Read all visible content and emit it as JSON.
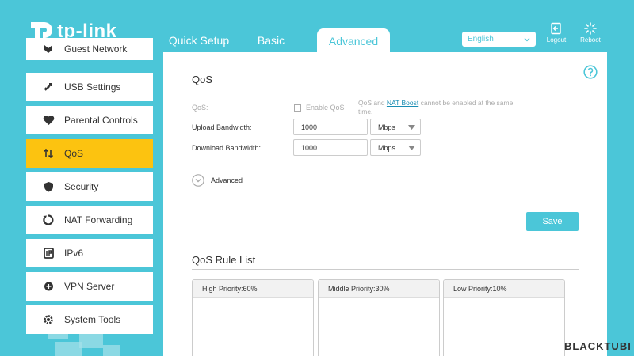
{
  "brand": {
    "name": "tp-link"
  },
  "tabs": [
    {
      "label": "Quick Setup",
      "active": false
    },
    {
      "label": "Basic",
      "active": false
    },
    {
      "label": "Advanced",
      "active": true
    }
  ],
  "header": {
    "language": "English",
    "logout_label": "Logout",
    "reboot_label": "Reboot"
  },
  "sidebar": {
    "items": [
      {
        "label": "Guest Network",
        "icon": "guest-network-icon"
      },
      {
        "label": "USB Settings",
        "icon": "usb-icon"
      },
      {
        "label": "Parental Controls",
        "icon": "parental-heart-icon"
      },
      {
        "label": "QoS",
        "icon": "qos-arrows-icon",
        "active": true
      },
      {
        "label": "Security",
        "icon": "shield-icon"
      },
      {
        "label": "NAT Forwarding",
        "icon": "nat-forwarding-icon"
      },
      {
        "label": "IPv6",
        "icon": "ipv6-icon"
      },
      {
        "label": "VPN Server",
        "icon": "vpn-icon"
      },
      {
        "label": "System Tools",
        "icon": "gear-icon"
      }
    ]
  },
  "qos": {
    "title": "QoS",
    "qos_label": "QoS:",
    "enable_label": "Enable QoS",
    "enabled": false,
    "note_pre": "QoS and ",
    "note_link": "NAT Boost",
    "note_post": " cannot be enabled at the same time.",
    "upload_label": "Upload Bandwidth:",
    "upload_value": "1000",
    "upload_unit": "Mbps",
    "download_label": "Download Bandwidth:",
    "download_value": "1000",
    "download_unit": "Mbps",
    "advanced_label": "Advanced",
    "save_label": "Save"
  },
  "rule_list": {
    "title": "QoS Rule List",
    "columns": [
      {
        "label": "High Priority:60%"
      },
      {
        "label": "Middle Priority:30%"
      },
      {
        "label": "Low Priority:10%"
      }
    ]
  },
  "watermark": "BLACKTUBI",
  "colors": {
    "accent": "#4bc6d8",
    "active_item": "#fcc310"
  }
}
